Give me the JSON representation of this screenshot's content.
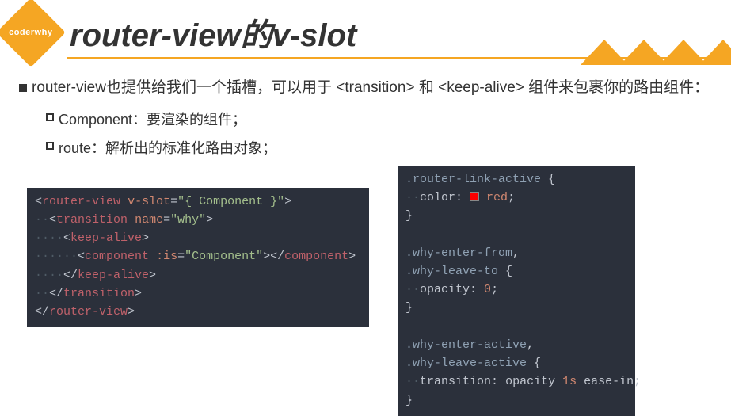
{
  "logo_text": "coderwhy",
  "title": "router-view的v-slot",
  "bullets": {
    "l1": "router-view也提供给我们一个插槽，可以用于 <transition> 和 <keep-alive> 组件来包裹你的路由组件：",
    "l2a": "Component：要渲染的组件；",
    "l2b": "route：解析出的标准化路由对象；"
  },
  "code_left": {
    "l1_open": "<",
    "l1_tag": "router-view",
    "l1_sp": " ",
    "l1_attr": "v-slot",
    "l1_eq": "=",
    "l1_str": "\"{ Component }\"",
    "l1_close": ">",
    "l2_ind": "··",
    "l2_open": "<",
    "l2_tag": "transition",
    "l2_sp": " ",
    "l2_attr": "name",
    "l2_eq": "=",
    "l2_str": "\"why\"",
    "l2_close": ">",
    "l3_ind": "····",
    "l3_open": "<",
    "l3_tag": "keep-alive",
    "l3_close": ">",
    "l4_ind": "······",
    "l4_open": "<",
    "l4_tag": "component",
    "l4_sp": " ",
    "l4_attr": ":is",
    "l4_eq": "=",
    "l4_str": "\"Component\"",
    "l4_mid": "></",
    "l4_tag2": "component",
    "l4_close": ">",
    "l5_ind": "····",
    "l5_open": "</",
    "l5_tag": "keep-alive",
    "l5_close": ">",
    "l6_ind": "··",
    "l6_open": "</",
    "l6_tag": "transition",
    "l6_close": ">",
    "l7_open": "</",
    "l7_tag": "router-view",
    "l7_close": ">"
  },
  "code_right": {
    "r1_sel": ".router-link-active",
    "r1_sp": " ",
    "r1_brace": "{",
    "r2_ind": "··",
    "r2_prop": "color:",
    "r2_sp": " ",
    "r2_val": " red",
    "r2_semi": ";",
    "r3_brace": "}",
    "r4_blank": "",
    "r5_sel": ".why-enter-from",
    "r5_comma": ",",
    "r6_sel": ".why-leave-to",
    "r6_sp": " ",
    "r6_brace": "{",
    "r7_ind": "··",
    "r7_prop": "opacity:",
    "r7_sp": " ",
    "r7_val": "0",
    "r7_semi": ";",
    "r8_brace": "}",
    "r9_blank": "",
    "r10_sel": ".why-enter-active",
    "r10_comma": ",",
    "r11_sel": ".why-leave-active",
    "r11_sp": " ",
    "r11_brace": "{",
    "r12_ind": "··",
    "r12_prop": "transition:",
    "r12_sp": " ",
    "r12_val1": "opacity ",
    "r12_dur": "1s",
    "r12_val2": " ease-in",
    "r12_semi": ";",
    "r13_brace": "}"
  }
}
